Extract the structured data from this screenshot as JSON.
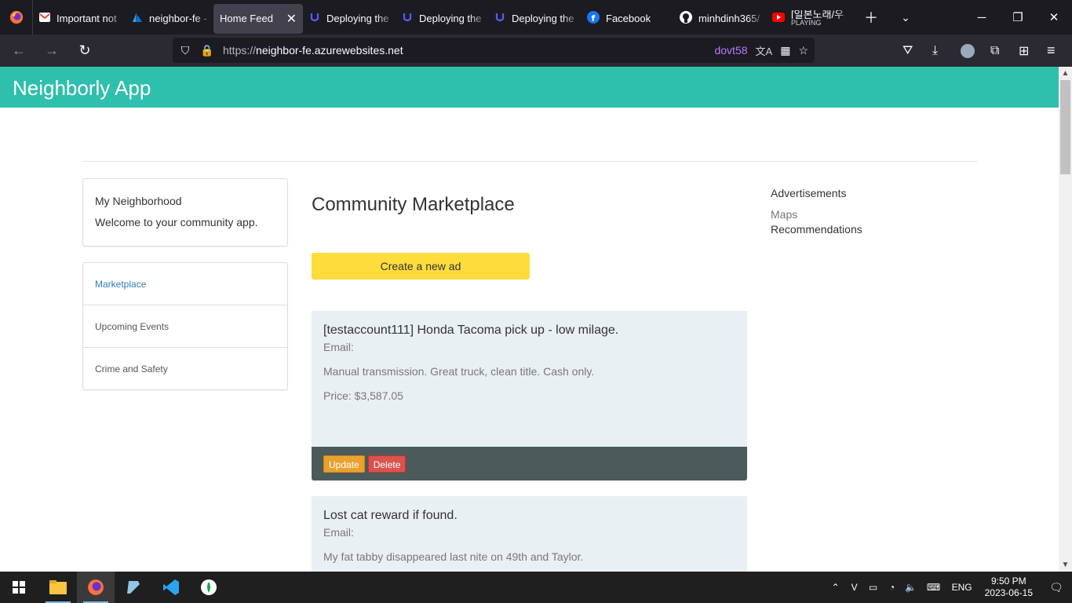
{
  "browser": {
    "tabs": [
      {
        "label": "Important not",
        "icon": "gmail-icon",
        "bar": ""
      },
      {
        "label": "neighbor-fe -",
        "icon": "azure-icon",
        "bar": "#a855f7"
      },
      {
        "label": "Home Feed",
        "icon": "",
        "bar": "#a855f7",
        "active": true
      },
      {
        "label": "Deploying the",
        "icon": "udacity-icon",
        "bar": "#84cc16"
      },
      {
        "label": "Deploying the",
        "icon": "udacity-icon",
        "bar": "#84cc16"
      },
      {
        "label": "Deploying the",
        "icon": "udacity-icon",
        "bar": "#84cc16"
      },
      {
        "label": "Facebook",
        "icon": "facebook-icon",
        "bar": ""
      },
      {
        "label": "minhdinh365/",
        "icon": "github-icon",
        "bar": ""
      },
      {
        "label": "[일본노래/우",
        "sublabel": "PLAYING",
        "icon": "youtube-icon",
        "bar": ""
      }
    ],
    "url_proto": "https://",
    "url_host": "neighbor-fe.azurewebsites.net",
    "profile": "dovt58"
  },
  "app": {
    "title": "Neighborly App",
    "welcome": {
      "heading": "My Neighborhood",
      "text": "Welcome to your community app."
    },
    "nav": [
      {
        "label": "Marketplace",
        "active": true
      },
      {
        "label": "Upcoming Events"
      },
      {
        "label": "Crime and Safety"
      }
    ],
    "main": {
      "title": "Community Marketplace",
      "create_label": "Create a new ad",
      "listings": [
        {
          "title": "[testaccount111] Honda Tacoma pick up - low milage.",
          "email": "Email:",
          "desc": "Manual transmission. Great truck, clean title. Cash only.",
          "price": "Price: $3,587.05",
          "update": "Update",
          "delete": "Delete"
        },
        {
          "title": "Lost cat reward if found.",
          "email": "Email:",
          "desc": "My fat tabby disappeared last nite on 49th and Taylor."
        }
      ]
    },
    "ads": {
      "heading": "Advertisements",
      "maps": "Maps",
      "recommendations": "Recommendations"
    }
  },
  "taskbar": {
    "lang": "ENG",
    "time": "9:50 PM",
    "date": "2023-06-15"
  },
  "colors": {
    "header": "#2fbfad",
    "create_button": "#fddc3c",
    "card_bg": "#e9f0f3",
    "card_footer": "#4b5a5a"
  }
}
